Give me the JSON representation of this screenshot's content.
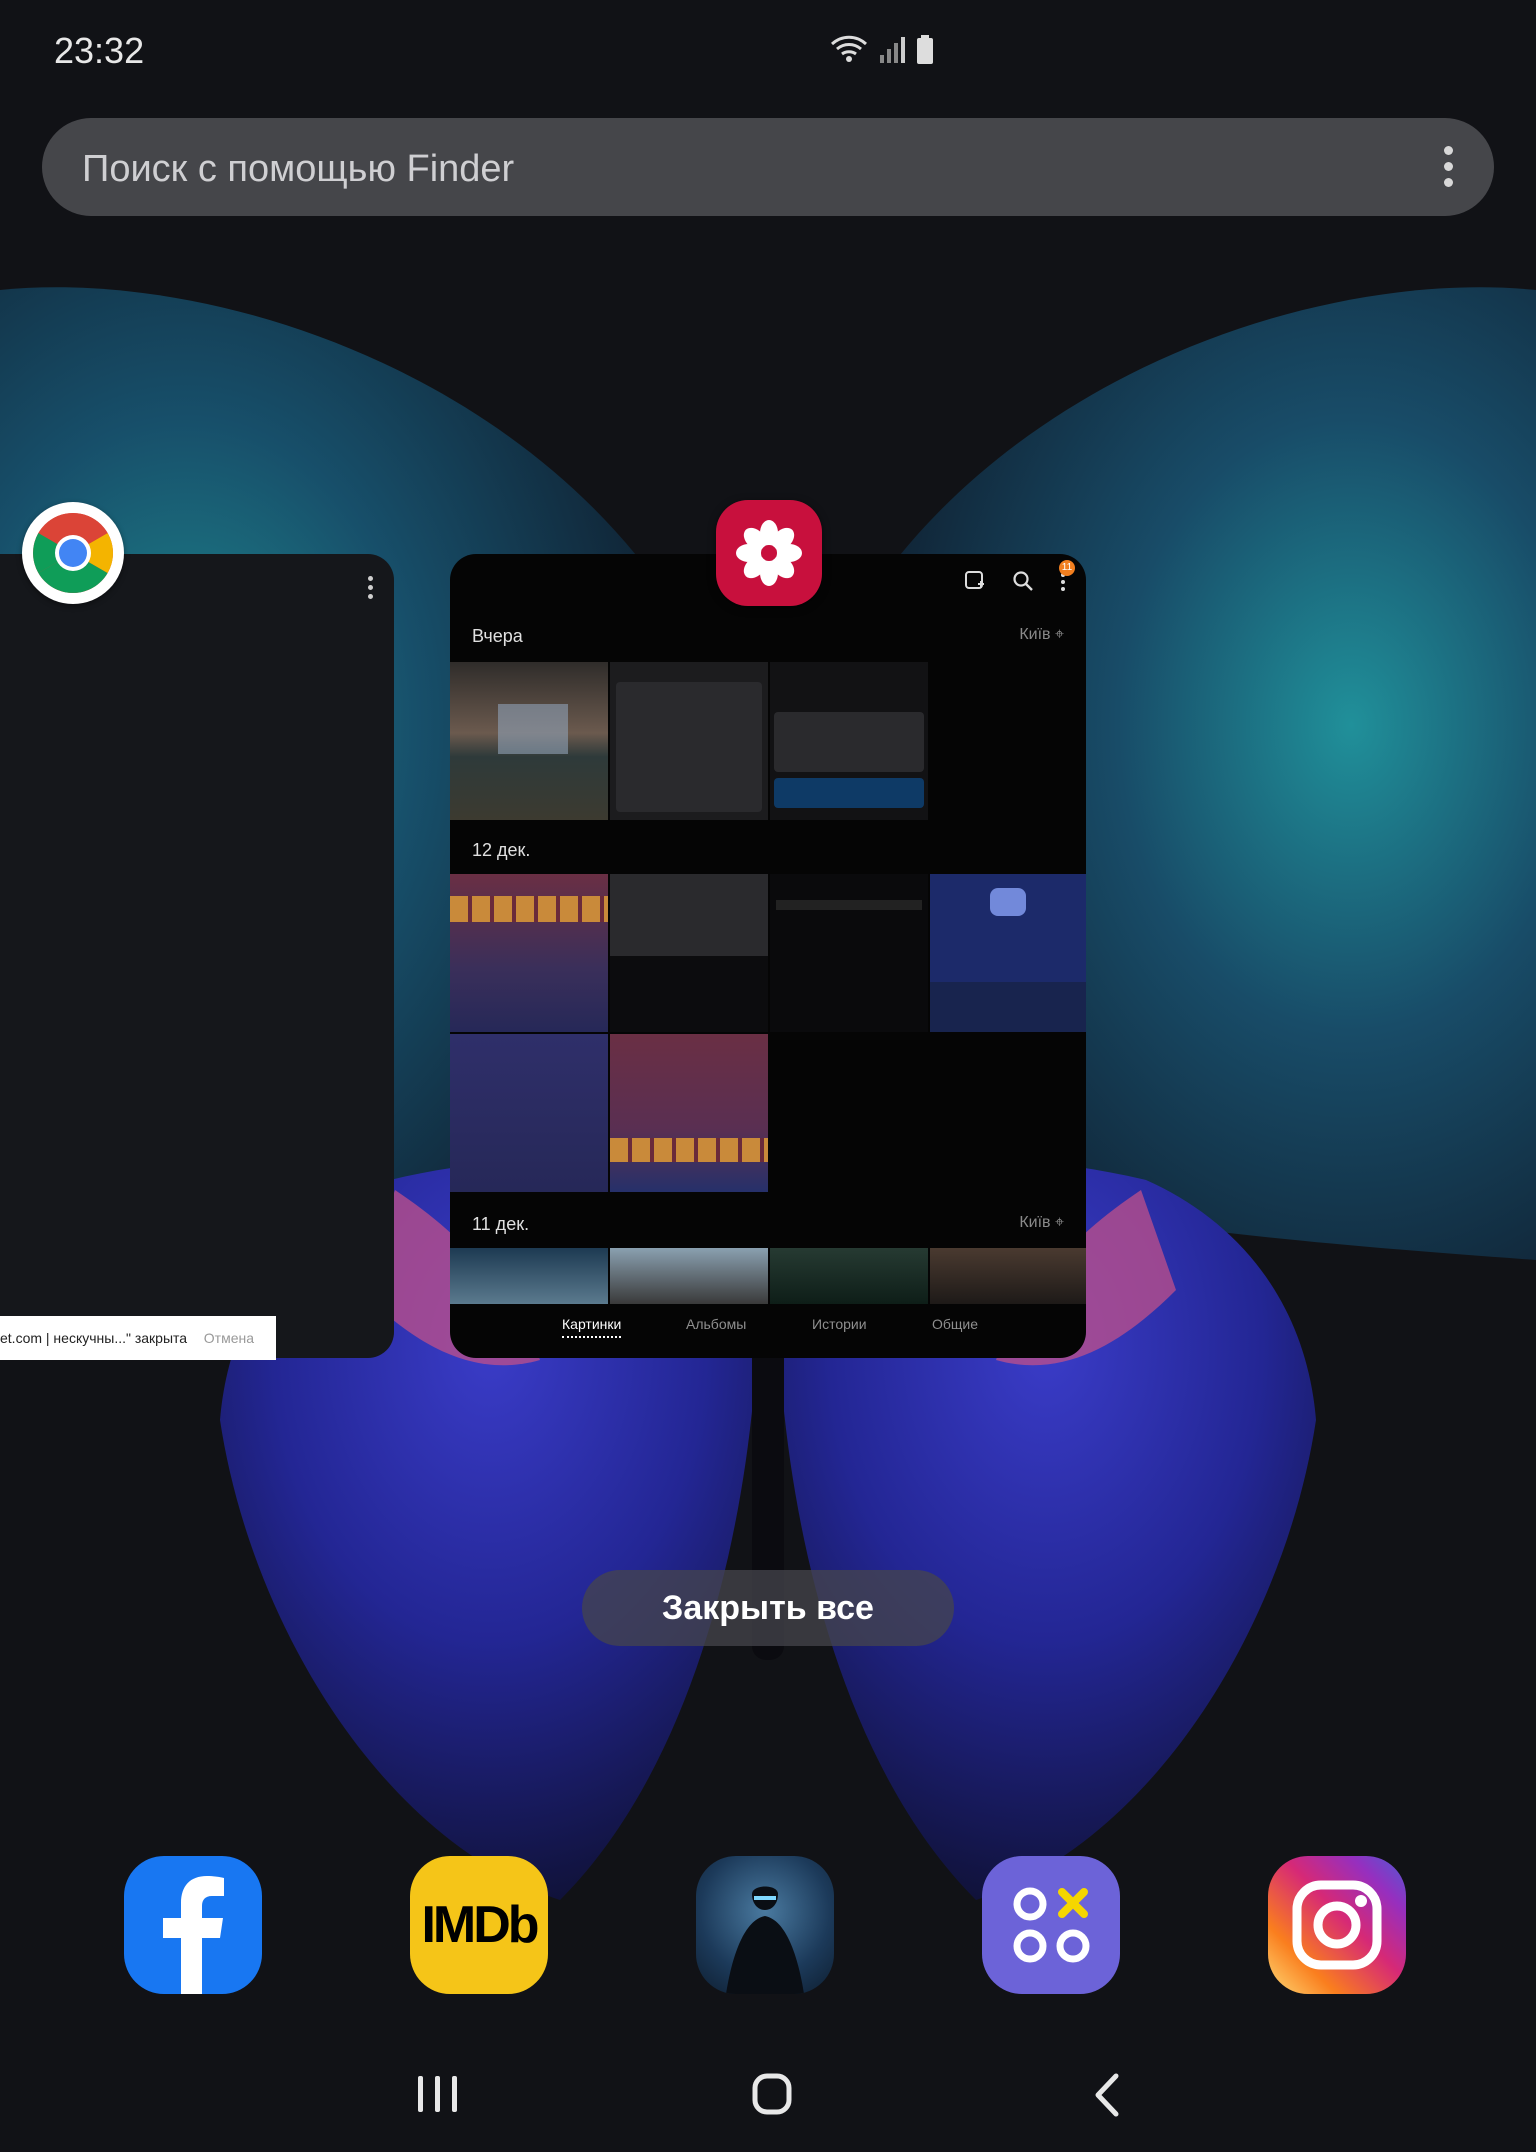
{
  "status": {
    "time": "23:32"
  },
  "search": {
    "placeholder": "Поиск с помощью Finder"
  },
  "chrome_card": {
    "toast_message": "et.com | нескучны...\" закрыта",
    "toast_action": "Отмена"
  },
  "gallery_card": {
    "sections": [
      {
        "label": "Вчера",
        "location": "Київ"
      },
      {
        "label": "12 дек.",
        "location": ""
      },
      {
        "label": "11 дек.",
        "location": "Київ"
      }
    ],
    "tabs": [
      "Картинки",
      "Альбомы",
      "Истории",
      "Общие"
    ],
    "active_tab": "Картинки",
    "notification_badge": "11"
  },
  "close_all_label": "Закрыть все",
  "dock": {
    "apps": [
      "facebook",
      "imdb",
      "shadow-fight-game",
      "game-launcher",
      "instagram"
    ],
    "imdb_text": "IMDb"
  },
  "colors": {
    "gallery_brand": "#c8103d",
    "facebook_blue": "#1877f2",
    "imdb_yellow": "#f5c518",
    "launcher_purple": "#6c63d8"
  }
}
